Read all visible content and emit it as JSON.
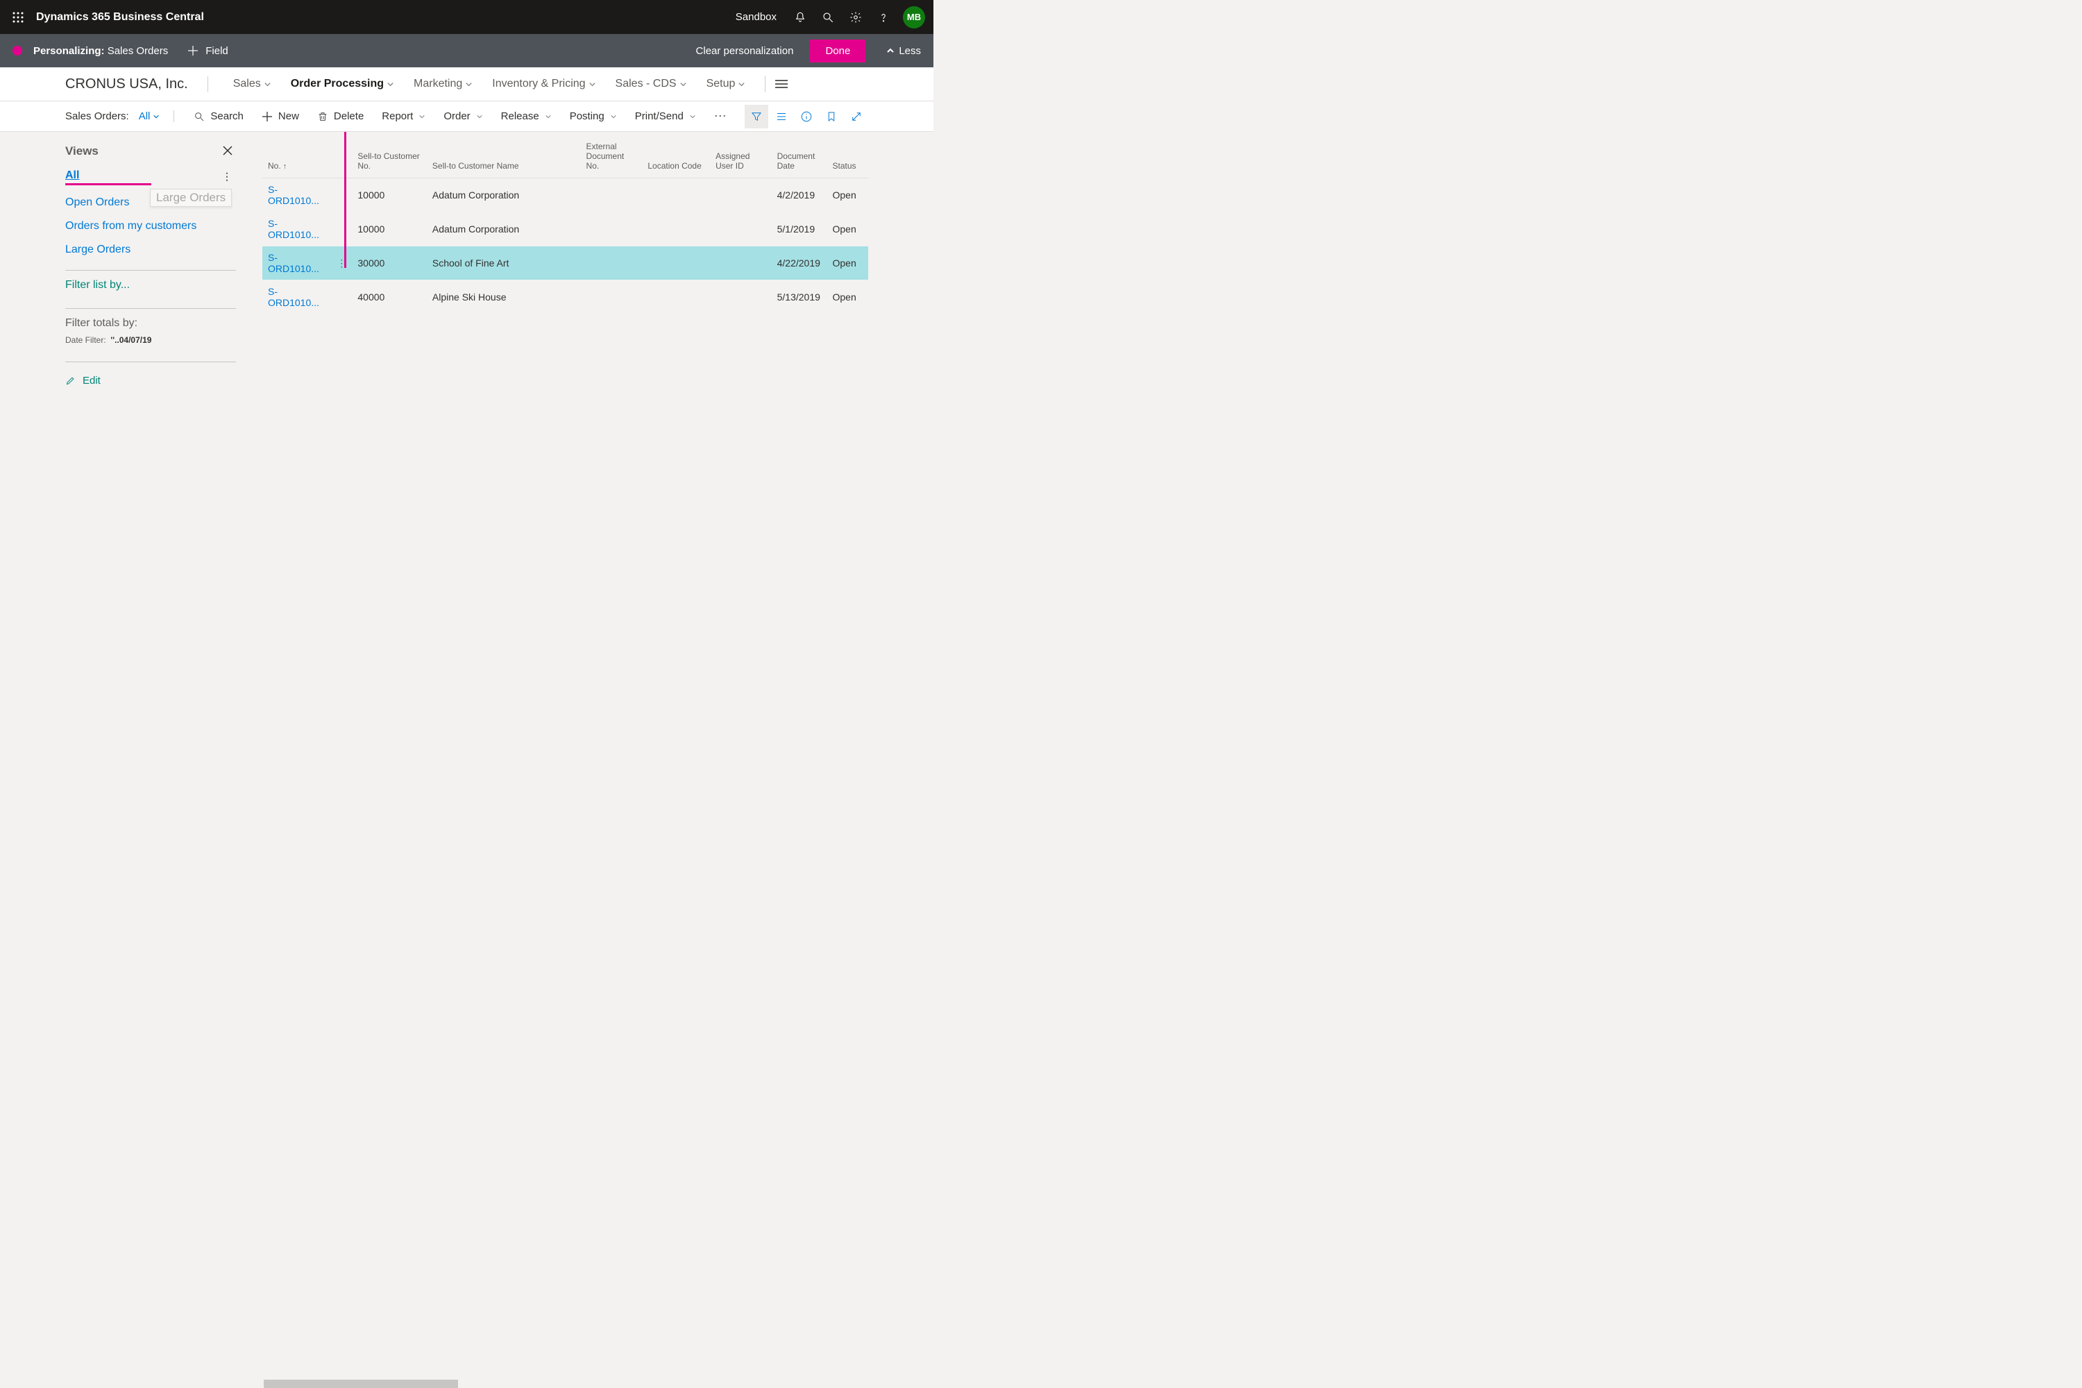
{
  "header": {
    "app_title": "Dynamics 365 Business Central",
    "env": "Sandbox",
    "avatar": "MB"
  },
  "personalize": {
    "prefix": "Personalizing:",
    "page": "Sales Orders",
    "add_field": "Field",
    "clear": "Clear personalization",
    "done": "Done",
    "less": "Less"
  },
  "nav": {
    "company": "CRONUS USA, Inc.",
    "items": [
      "Sales",
      "Order Processing",
      "Marketing",
      "Inventory & Pricing",
      "Sales - CDS",
      "Setup"
    ],
    "active_index": 1
  },
  "actions": {
    "list_label": "Sales Orders:",
    "current_filter": "All",
    "search": "Search",
    "new": "New",
    "delete": "Delete",
    "dropdowns": [
      "Report",
      "Order",
      "Release",
      "Posting",
      "Print/Send"
    ]
  },
  "views": {
    "title": "Views",
    "items": [
      "All",
      "Open Orders",
      "Orders from my customers",
      "Large Orders"
    ],
    "active_index": 0,
    "drag_ghost": "Large Orders",
    "filter_list": "Filter list by...",
    "filter_totals_heading": "Filter totals by:",
    "date_filter_label": "Date Filter:",
    "date_filter_value": "''..04/07/19",
    "edit": "Edit"
  },
  "table": {
    "columns": [
      "No.",
      "Sell-to Customer No.",
      "Sell-to Customer Name",
      "External Document No.",
      "Location Code",
      "Assigned User ID",
      "Document Date",
      "Status"
    ],
    "sorted_col_index": 0,
    "rows": [
      {
        "no": "S-ORD1010...",
        "custno": "10000",
        "custname": "Adatum Corporation",
        "ext": "",
        "loc": "",
        "uid": "",
        "date": "4/2/2019",
        "status": "Open",
        "selected": false
      },
      {
        "no": "S-ORD1010...",
        "custno": "10000",
        "custname": "Adatum Corporation",
        "ext": "",
        "loc": "",
        "uid": "",
        "date": "5/1/2019",
        "status": "Open",
        "selected": false
      },
      {
        "no": "S-ORD1010...",
        "custno": "30000",
        "custname": "School of Fine Art",
        "ext": "",
        "loc": "",
        "uid": "",
        "date": "4/22/2019",
        "status": "Open",
        "selected": true
      },
      {
        "no": "S-ORD1010...",
        "custno": "40000",
        "custname": "Alpine Ski House",
        "ext": "",
        "loc": "",
        "uid": "",
        "date": "5/13/2019",
        "status": "Open",
        "selected": false
      }
    ]
  }
}
